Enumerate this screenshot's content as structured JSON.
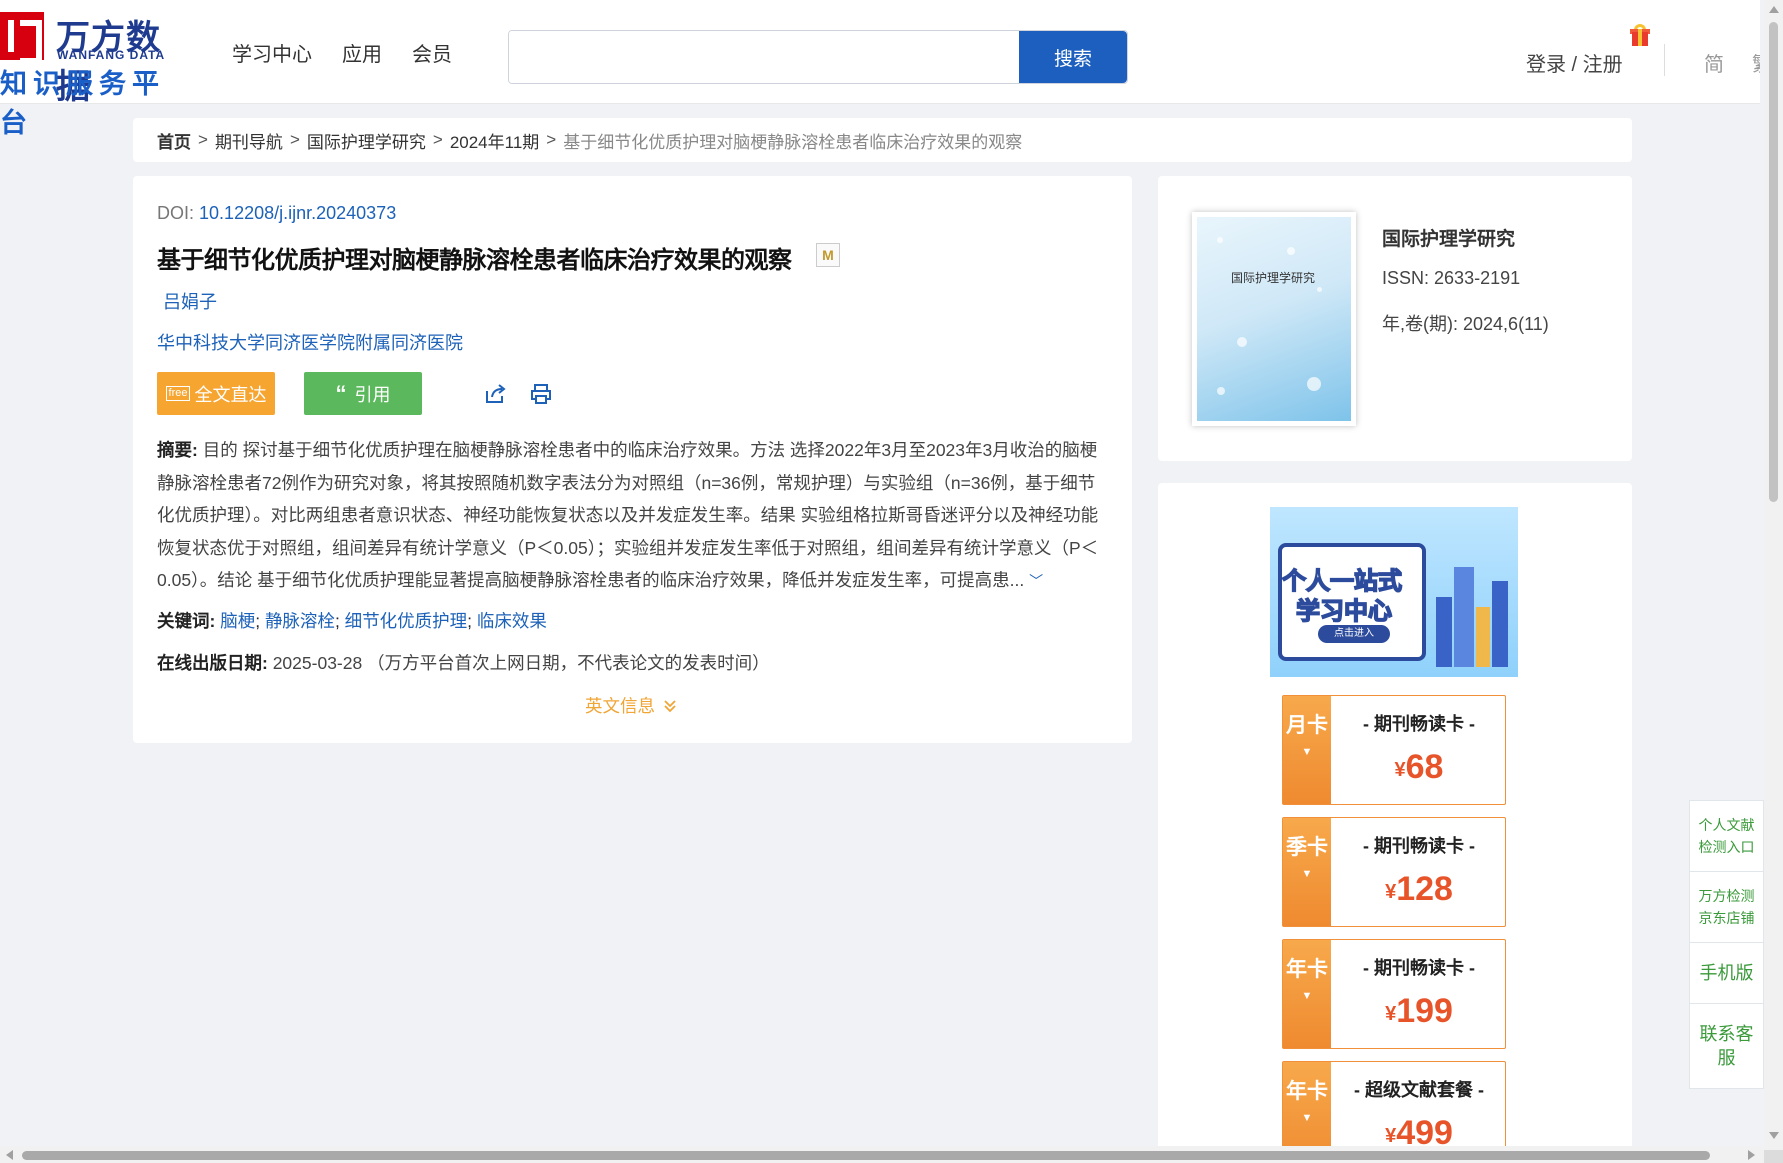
{
  "header": {
    "logo_cn": "万方数据",
    "logo_en": "WANFANG DATA",
    "logo_sub": "知识服务平台",
    "nav": [
      "学习中心",
      "应用",
      "会员"
    ],
    "search_placeholder": "",
    "search_button": "搜索",
    "login": "登录 / 注册",
    "lang_simplified": "简",
    "lang_traditional": "繁"
  },
  "breadcrumb": {
    "home": "首页",
    "items": [
      "期刊导航",
      "国际护理学研究",
      "2024年11期"
    ],
    "current": "基于细节化优质护理对脑梗静脉溶栓患者临床治疗效果的观察",
    "separator": ">"
  },
  "article": {
    "doi_label": "DOI:",
    "doi": "10.12208/j.ijnr.20240373",
    "title": "基于细节化优质护理对脑梗静脉溶栓患者临床治疗效果的观察",
    "m_badge": "M",
    "author": "吕娟子",
    "affiliation": "华中科技大学同济医学院附属同济医院",
    "btn_fulltext": "全文直达",
    "btn_fulltext_icon": "free",
    "btn_cite": "引用",
    "abstract_label": "摘要:",
    "abstract_text": "目的 探讨基于细节化优质护理在脑梗静脉溶栓患者中的临床治疗效果。方法 选择2022年3月至2023年3月收治的脑梗静脉溶栓患者72例作为研究对象，将其按照随机数字表法分为对照组（n=36例，常规护理）与实验组（n=36例，基于细节化优质护理）。对比两组患者意识状态、神经功能恢复状态以及并发症发生率。结果 实验组格拉斯哥昏迷评分以及神经功能恢复状态优于对照组，组间差异有统计学意义（P＜0.05）；实验组并发症发生率低于对照组，组间差异有统计学意义（P＜0.05）。结论 基于细节化优质护理能显著提高脑梗静脉溶栓患者的临床治疗效果，降低并发症发生率，可提高患...",
    "keywords_label": "关键词:",
    "keywords": [
      "脑梗",
      "静脉溶栓",
      "细节化优质护理",
      "临床效果"
    ],
    "pubdate_label": "在线出版日期:",
    "pubdate": "2025-03-28",
    "pubdate_note": "（万方平台首次上网日期，不代表论文的发表时间）",
    "english_info": "英文信息"
  },
  "journal": {
    "cover_title": "国际护理学研究",
    "name": "国际护理学研究",
    "issn_label": "ISSN:",
    "issn": "2633-2191",
    "issue_label": "年,卷(期):",
    "issue": "2024,6(11)"
  },
  "promo": {
    "banner_line1": "个人一站式",
    "banner_line2": "学习中心",
    "banner_enter": "点击进入",
    "cards": [
      {
        "side": "月卡",
        "name": "- 期刊畅读卡 -",
        "currency": "¥",
        "price": "68"
      },
      {
        "side": "季卡",
        "name": "- 期刊畅读卡 -",
        "currency": "¥",
        "price": "128"
      },
      {
        "side": "年卡",
        "name": "- 期刊畅读卡 -",
        "currency": "¥",
        "price": "199"
      },
      {
        "side": "年卡",
        "name": "- 超级文献套餐 -",
        "currency": "¥",
        "price": "499"
      }
    ]
  },
  "side_tools": [
    "个人文献检测入口",
    "万方检测京东店铺",
    "手机版",
    "联系客服"
  ],
  "colors": {
    "brand_blue": "#1d5fbf",
    "link_blue": "#1d62b8",
    "orange": "#f6a531",
    "green": "#5cb85c",
    "price_red": "#e8542a"
  }
}
